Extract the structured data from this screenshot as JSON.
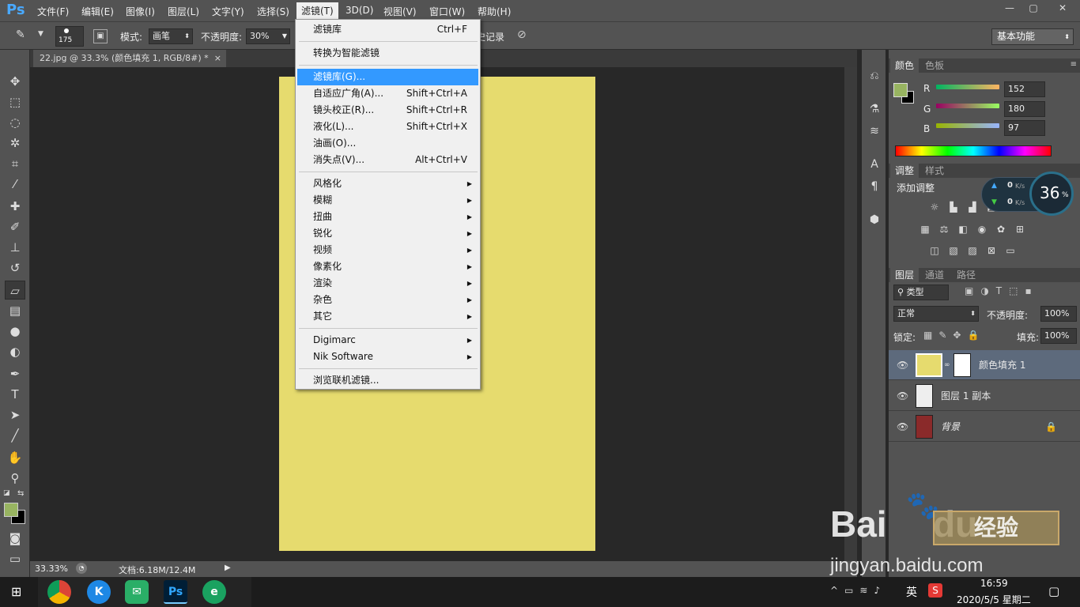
{
  "app": {
    "logo": "Ps"
  },
  "menubar": {
    "items": [
      "文件(F)",
      "编辑(E)",
      "图像(I)",
      "图层(L)",
      "文字(Y)",
      "选择(S)",
      "滤镜(T)",
      "3D(D)",
      "视图(V)",
      "窗口(W)",
      "帮助(H)"
    ],
    "window_buttons": [
      "—",
      "▢",
      "✕"
    ]
  },
  "options_bar": {
    "brush_size": "175",
    "mode_label": "模式:",
    "mode_value": "画笔",
    "opacity_label": "不透明度:",
    "opacity_value": "30%",
    "history_label": "抹到历史记录",
    "workspace": "基本功能"
  },
  "document": {
    "tab_title": "22.jpg @ 33.3% (颜色填充 1, RGB/8#) *",
    "tab_close": "×",
    "canvas_color": "#e6db6e",
    "zoom": "33.33%",
    "doc_info": "文档:6.18M/12.4M"
  },
  "filter_menu": {
    "groups": [
      [
        {
          "label": "滤镜库",
          "shortcut": "Ctrl+F"
        }
      ],
      [
        {
          "label": "转换为智能滤镜",
          "shortcut": ""
        }
      ],
      [
        {
          "label": "滤镜库(G)...",
          "shortcut": "",
          "highlighted": true
        },
        {
          "label": "自适应广角(A)...",
          "shortcut": "Shift+Ctrl+A"
        },
        {
          "label": "镜头校正(R)...",
          "shortcut": "Shift+Ctrl+R"
        },
        {
          "label": "液化(L)...",
          "shortcut": "Shift+Ctrl+X"
        },
        {
          "label": "油画(O)...",
          "shortcut": ""
        },
        {
          "label": "消失点(V)...",
          "shortcut": "Alt+Ctrl+V"
        }
      ],
      [
        {
          "label": "风格化",
          "submenu": true
        },
        {
          "label": "模糊",
          "submenu": true
        },
        {
          "label": "扭曲",
          "submenu": true
        },
        {
          "label": "锐化",
          "submenu": true
        },
        {
          "label": "视频",
          "submenu": true
        },
        {
          "label": "像素化",
          "submenu": true
        },
        {
          "label": "渲染",
          "submenu": true
        },
        {
          "label": "杂色",
          "submenu": true
        },
        {
          "label": "其它",
          "submenu": true
        }
      ],
      [
        {
          "label": "Digimarc",
          "submenu": true
        },
        {
          "label": "Nik Software",
          "submenu": true
        }
      ],
      [
        {
          "label": "浏览联机滤镜...",
          "shortcut": ""
        }
      ]
    ]
  },
  "color_panel": {
    "tabs": [
      "颜色",
      "色板"
    ],
    "r_label": "R",
    "r": "152",
    "g_label": "G",
    "g": "180",
    "b_label": "B",
    "b": "97",
    "fg_color": "#98b461"
  },
  "adjust_panel": {
    "tabs": [
      "调整",
      "样式"
    ],
    "add_label": "添加调整"
  },
  "speed_widget": {
    "up": "0",
    "down": "0",
    "unit": "K/s",
    "percent": "36",
    "pct_sign": "%"
  },
  "layers_panel": {
    "tabs": [
      "图层",
      "通道",
      "路径"
    ],
    "filter_label": "类型",
    "blend_mode": "正常",
    "opacity_label": "不透明度:",
    "opacity_value": "100%",
    "lock_label": "锁定:",
    "fill_label": "填充:",
    "fill_value": "100%",
    "layers": [
      {
        "name": "颜色填充 1",
        "selected": true
      },
      {
        "name": "图层 1 副本",
        "selected": false
      },
      {
        "name": "背景",
        "selected": false
      }
    ]
  },
  "watermark": {
    "brand": "Bai",
    "brand2": "du",
    "cn": "经验",
    "url": "jingyan.baidu.com"
  },
  "taskbar": {
    "ime": "英",
    "time": "16:59",
    "date": "2020/5/5 星期二"
  }
}
